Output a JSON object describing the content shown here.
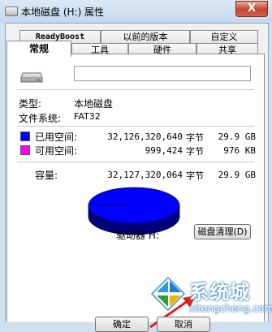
{
  "window": {
    "title": "本地磁盘 (H:) 属性",
    "close_glyph": "X"
  },
  "tabs_row1": [
    {
      "label": "ReadyBoost"
    },
    {
      "label": "以前的版本"
    },
    {
      "label": "自定义"
    }
  ],
  "tabs_row2": [
    {
      "label": "常规",
      "active": true
    },
    {
      "label": "工具"
    },
    {
      "label": "硬件"
    },
    {
      "label": "共享"
    }
  ],
  "general": {
    "drive_name_value": "",
    "type_label": "类型:",
    "type_value": "本地磁盘",
    "fs_label": "文件系统:",
    "fs_value": "FAT32",
    "used": {
      "label": "已用空间:",
      "bytes": "32,126,320,640",
      "unit": "字节",
      "size": "29.9 GB",
      "color": "#0000ff"
    },
    "free": {
      "label": "可用空间:",
      "bytes": "999,424",
      "unit": "字节",
      "size": "976 KB",
      "color": "#ff00ff"
    },
    "capacity": {
      "label": "容量:",
      "bytes": "32,127,320,064",
      "unit": "字节",
      "size": "29.9 GB"
    },
    "drive_label": "驱动器 H:",
    "cleanup_button": "磁盘清理(D)"
  },
  "footer": {
    "ok_button": "确定",
    "cancel_button": "取消"
  },
  "watermark": {
    "brand": "系统城",
    "url": "xitongcheng.com"
  },
  "colors": {
    "arrow": "#e02020",
    "pie_used": "#0000ff"
  }
}
